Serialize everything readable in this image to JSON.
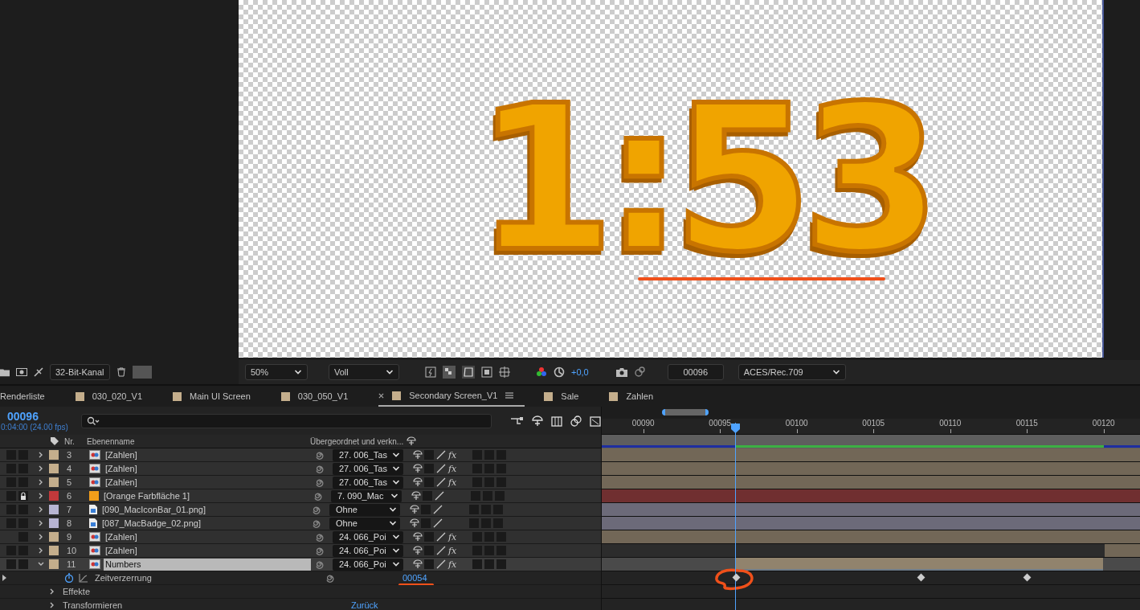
{
  "viewer": {
    "display_text": "1:53",
    "annotated": true
  },
  "left_toolbar": {
    "bit_depth": "32-Bit-Kanal"
  },
  "viewer_toolbar": {
    "zoom": "50%",
    "resolution": "Voll",
    "exposure": "+0,0",
    "timecode": "00096",
    "color_space": "ACES/Rec.709"
  },
  "tabs": [
    {
      "label": "Renderliste",
      "selected": false
    },
    {
      "label": "030_020_V1",
      "color": "#c4ae8c",
      "selected": false
    },
    {
      "label": "Main UI Screen",
      "color": "#c4ae8c",
      "selected": false
    },
    {
      "label": "030_050_V1",
      "color": "#c4ae8c",
      "selected": false
    },
    {
      "label": "Secondary Screen_V1",
      "color": "#c4ae8c",
      "selected": true
    },
    {
      "label": "Sale",
      "color": "#c4ae8c",
      "selected": false
    },
    {
      "label": "Zahlen",
      "color": "#c4ae8c",
      "selected": false
    }
  ],
  "comp": {
    "timecode": "00096",
    "duration": "0:04:00 (24.00 fps)"
  },
  "columns": {
    "number": "Nr.",
    "name": "Ebenenname",
    "parent": "Übergeordnet und verkn..."
  },
  "ruler": [
    "00090",
    "00095",
    "00100",
    "00105",
    "00110",
    "00115",
    "00120"
  ],
  "layers": [
    {
      "nr": "3",
      "name": "[Zahlen]",
      "kind": "comp",
      "color": "#c4ae8c",
      "parent": "27. 006_Tas",
      "fx": {
        "label": "fx",
        "on": true
      },
      "locked": false,
      "video": true,
      "expanded": false,
      "selected": false,
      "bar": {
        "kind": "full"
      }
    },
    {
      "nr": "4",
      "name": "[Zahlen]",
      "kind": "comp",
      "color": "#c4ae8c",
      "parent": "27. 006_Tas",
      "fx": {
        "label": "fx",
        "on": true
      },
      "locked": false,
      "video": true,
      "expanded": false,
      "selected": false,
      "bar": {
        "kind": "full"
      }
    },
    {
      "nr": "5",
      "name": "[Zahlen]",
      "kind": "comp",
      "color": "#c4ae8c",
      "parent": "27. 006_Tas",
      "fx": {
        "label": "fx",
        "on": true
      },
      "locked": false,
      "video": true,
      "expanded": false,
      "selected": false,
      "bar": {
        "kind": "full"
      }
    },
    {
      "nr": "6",
      "name": "[Orange Farbfläche 1]",
      "kind": "solid",
      "color": "#c1393b",
      "parent": "7. 090_Mac",
      "locked": true,
      "video": true,
      "expanded": false,
      "selected": false,
      "bar": {
        "kind": "full"
      }
    },
    {
      "nr": "7",
      "name": "[090_MacIconBar_01.png]",
      "kind": "image",
      "color": "#b7b4d2",
      "parent": "Ohne",
      "locked": false,
      "video": true,
      "expanded": false,
      "selected": false,
      "bar": {
        "kind": "full"
      }
    },
    {
      "nr": "8",
      "name": "[087_MacBadge_02.png]",
      "kind": "image",
      "color": "#b7b4d2",
      "parent": "Ohne",
      "locked": false,
      "video": true,
      "expanded": false,
      "selected": false,
      "bar": {
        "kind": "full"
      }
    },
    {
      "nr": "9",
      "name": "[Zahlen]",
      "kind": "comp",
      "color": "#c4ae8c",
      "parent": "24. 066_Poi",
      "fx": {
        "label": "fx",
        "on": true
      },
      "locked": false,
      "video": false,
      "expanded": false,
      "selected": false,
      "bar": {
        "kind": "full"
      }
    },
    {
      "nr": "10",
      "name": "[Zahlen]",
      "kind": "comp",
      "color": "#c4ae8c",
      "parent": "24. 066_Poi",
      "fx": {
        "label": "fx",
        "on": true
      },
      "locked": false,
      "video": true,
      "expanded": false,
      "selected": false,
      "bar": {
        "kind": "tail"
      }
    },
    {
      "nr": "11",
      "name": "Numbers",
      "kind": "comp",
      "color": "#c4ae8c",
      "parent": "24. 066_Poi",
      "fx": {
        "label": "fx",
        "on": true
      },
      "locked": false,
      "video": true,
      "expanded": true,
      "selected": true,
      "bar": {
        "kind": "from_playhead"
      }
    }
  ],
  "properties": [
    {
      "kind": "time_remap",
      "label": "Zeitverzerrung",
      "value": "00054",
      "annotated": true
    },
    {
      "kind": "group",
      "label": "Effekte",
      "annotated": false
    },
    {
      "kind": "group",
      "label": "Transformieren",
      "value": "Zurück",
      "annotated": false
    }
  ]
}
